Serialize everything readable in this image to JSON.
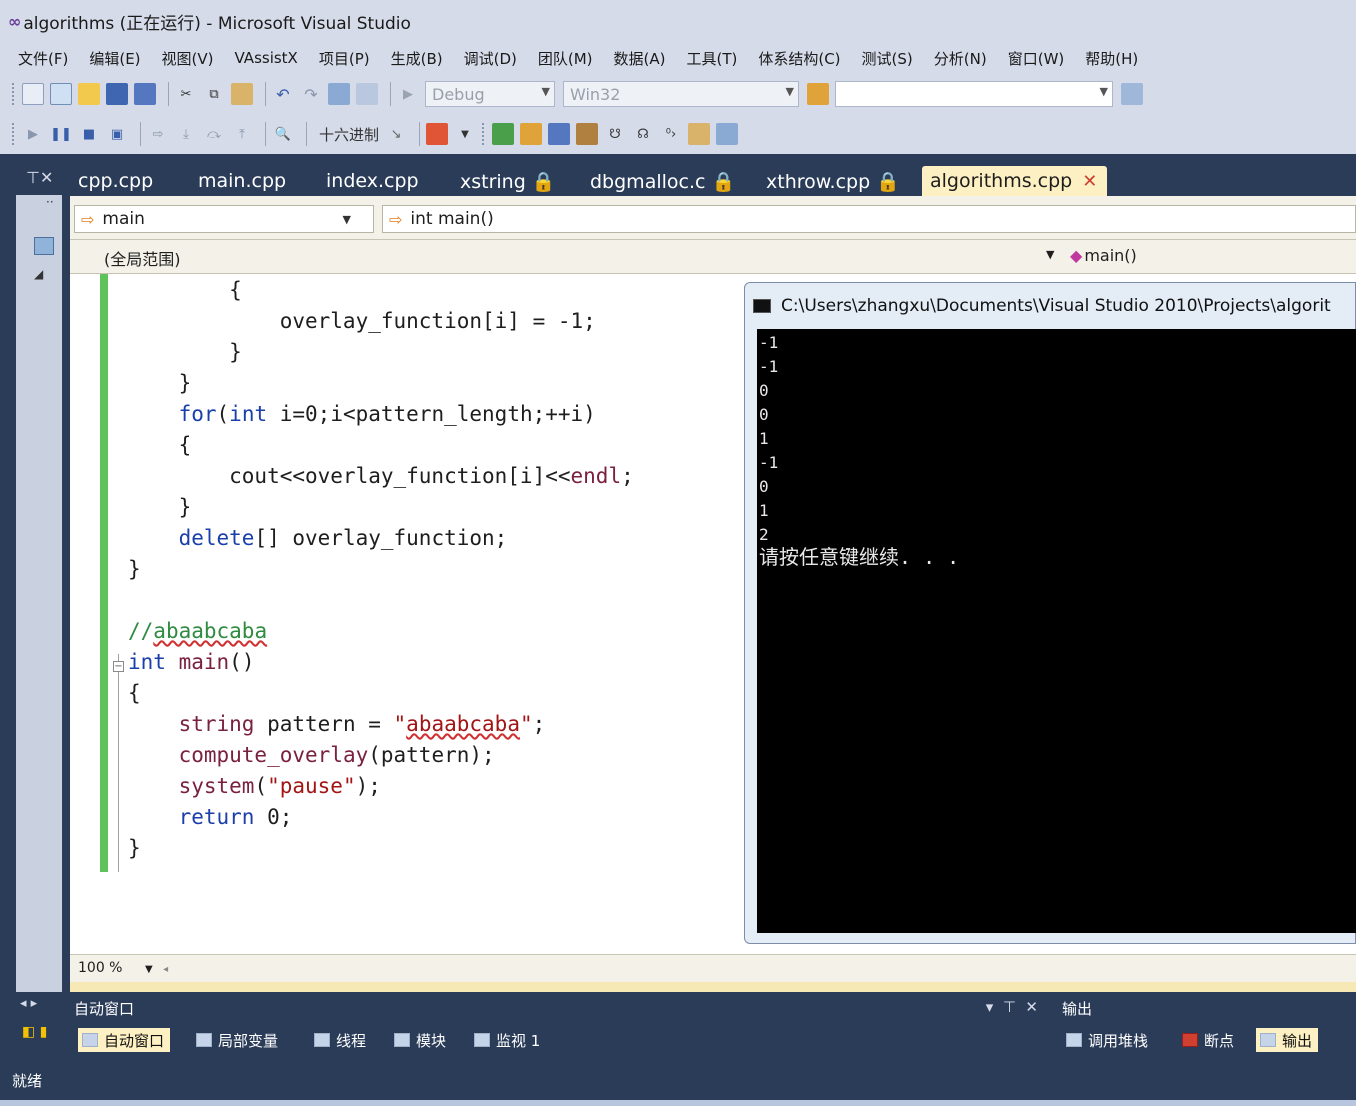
{
  "window": {
    "title": "algorithms (正在运行) - Microsoft Visual Studio",
    "app_icon": "∞"
  },
  "menubar": {
    "items": [
      "文件(F)",
      "编辑(E)",
      "视图(V)",
      "VAssistX",
      "项目(P)",
      "生成(B)",
      "调试(D)",
      "团队(M)",
      "数据(A)",
      "工具(T)",
      "体系结构(C)",
      "测试(S)",
      "分析(N)",
      "窗口(W)",
      "帮助(H)"
    ]
  },
  "toolbar": {
    "config": "Debug",
    "platform": "Win32",
    "hex_label": "十六进制"
  },
  "tabs": [
    {
      "label": "cpp.cpp"
    },
    {
      "label": "main.cpp"
    },
    {
      "label": "index.cpp"
    },
    {
      "label": "xstring 🔒"
    },
    {
      "label": "dbgmalloc.c 🔒"
    },
    {
      "label": "xthrow.cpp 🔒"
    },
    {
      "label": "algorithms.cpp",
      "active": true
    }
  ],
  "navbar": {
    "left_combo": "main",
    "right_combo": "int main()",
    "scope": "(全局范围)",
    "member": "main()"
  },
  "code": {
    "lines": [
      "        {",
      "            overlay_function[i] = -1;",
      "        }",
      "    }",
      "    for(int i=0;i<pattern_length;++i)",
      "    {",
      "        cout<<overlay_function[i]<<endl;",
      "    }",
      "    delete[] overlay_function;",
      "}",
      "",
      "//abaabcaba",
      "int main()",
      "{",
      "    string pattern = \"abaabcaba\";",
      "    compute_overlay(pattern);",
      "    system(\"pause\");",
      "    return 0;",
      "}"
    ]
  },
  "zoom": "100 %",
  "console": {
    "title": "C:\\Users\\zhangxu\\Documents\\Visual Studio 2010\\Projects\\algorit",
    "output": [
      "-1",
      "-1",
      "0",
      "0",
      "1",
      "-1",
      "0",
      "1",
      "2"
    ],
    "prompt": "请按任意键继续. . ."
  },
  "bottom": {
    "autos_title": "自动窗口",
    "output_title": "输出",
    "left_tabs": [
      "自动窗口",
      "局部变量",
      "线程",
      "模块",
      "监视 1"
    ],
    "right_tabs": [
      "调用堆栈",
      "断点",
      "输出"
    ]
  },
  "status": {
    "text": "就绪"
  },
  "colors": {
    "tab_active": "#fdf0c3",
    "chrome": "#2b3c59",
    "margin_green": "#5fc35b",
    "console_bg": "#000000"
  }
}
